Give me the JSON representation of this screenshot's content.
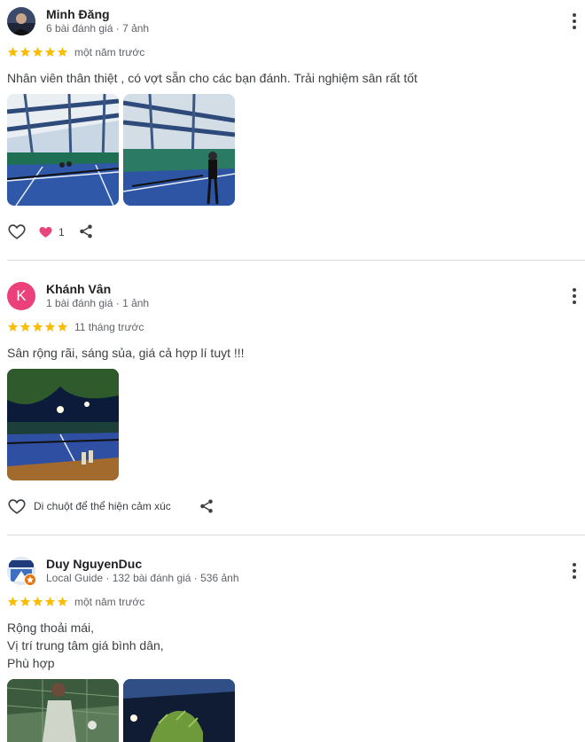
{
  "colors": {
    "star": "#fbbc04",
    "avatar_k": "#ec407a",
    "divider": "#dadce0",
    "muted": "#5f6368"
  },
  "reviews": [
    {
      "name": "Minh Đăng",
      "meta": "6 bài đánh giá · 7 ảnh",
      "rating": 5,
      "when": "một năm trước",
      "text": [
        "Nhân viên thân thiệt , có vợt sẵn cho các bạn đánh. Trải nghiệm sân rất tốt"
      ],
      "photos": 2,
      "like_count": "1",
      "icons": [
        "heart-outline-icon",
        "heart-filled-icon",
        "share-icon",
        "more-vert-icon"
      ]
    },
    {
      "name": "Khánh Vân",
      "avatar_letter": "K",
      "meta": "1 bài đánh giá · 1 ảnh",
      "rating": 5,
      "when": "11 tháng trước",
      "text": [
        "Sân rộng rãi, sáng sủa, giá cả hợp lí tuyt !!!"
      ],
      "photos": 1,
      "react_label": "Di chuột để thể hiện cảm xúc",
      "icons": [
        "heart-outline-icon",
        "share-icon",
        "more-vert-icon"
      ]
    },
    {
      "name": "Duy NguyenDuc",
      "meta": "Local Guide · 132 bài đánh giá · 536 ảnh",
      "rating": 5,
      "when": "một năm trước",
      "text": [
        "Rộng thoải mái,",
        "Vị trí trung tâm giá bình dân,",
        "Phù hợp"
      ],
      "photos": 2,
      "icons": [
        "local-guide-badge-icon",
        "more-vert-icon"
      ]
    }
  ]
}
